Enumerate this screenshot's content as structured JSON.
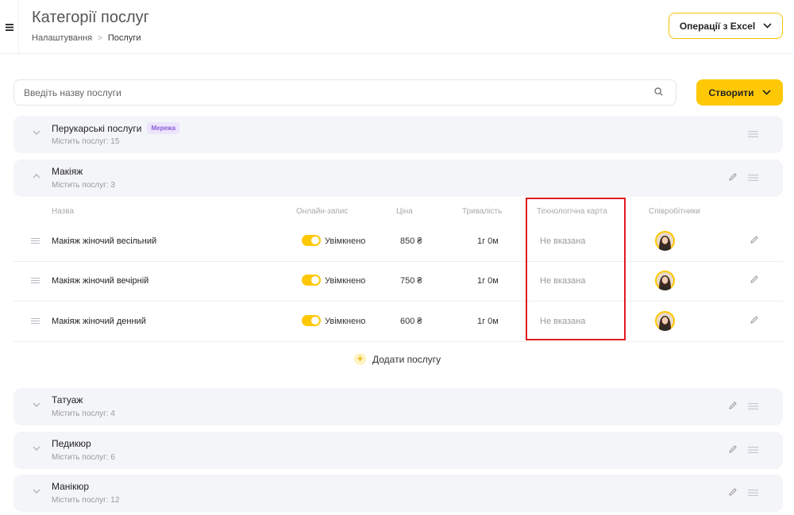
{
  "header": {
    "title": "Категорії послуг",
    "breadcrumb": {
      "parent": "Налаштування",
      "separator": ">",
      "current": "Послуги"
    },
    "excel_button": "Операції з Excel"
  },
  "search": {
    "placeholder": "Введіть назву послуги",
    "value": ""
  },
  "create_button": "Створити",
  "colors": {
    "accent": "#ffc805",
    "badge_bg": "#ece4fb",
    "badge_text": "#8b5fd6",
    "highlight": "#e11b22"
  },
  "categories": [
    {
      "name": "Перукарські послуги",
      "badge": "Мережа",
      "count": "Містить послуг: 15",
      "expanded": false
    },
    {
      "name": "Макіяж",
      "count": "Містить послуг: 3",
      "expanded": true
    },
    {
      "name": "Татуаж",
      "count": "Містить послуг: 4",
      "expanded": false
    },
    {
      "name": "Педикюр",
      "count": "Містить послуг: 6",
      "expanded": false
    },
    {
      "name": "Манікюр",
      "count": "Містить послуг: 12",
      "expanded": false
    }
  ],
  "table": {
    "columns": {
      "name": "Назва",
      "online": "Онлайн-запис",
      "price": "Ціна",
      "duration": "Тривалість",
      "techcard": "Технологічна карта",
      "staff": "Співробітники"
    },
    "rows": [
      {
        "name": "Макіяж жіночий весільний",
        "online": "Увімкнено",
        "online_on": true,
        "price": "850 ₴",
        "duration": "1г 0м",
        "techcard": "Не вказана"
      },
      {
        "name": "Макіяж жіночий вечірній",
        "online": "Увімкнено",
        "online_on": true,
        "price": "750 ₴",
        "duration": "1г 0м",
        "techcard": "Не вказана"
      },
      {
        "name": "Макіяж жіночий денний",
        "online": "Увімкнено",
        "online_on": true,
        "price": "600 ₴",
        "duration": "1г 0м",
        "techcard": "Не вказана"
      }
    ]
  },
  "add_service": {
    "plus": "+",
    "label": "Додати послугу"
  },
  "icons": [
    "menu-icon",
    "chevron-down-icon",
    "search-icon",
    "drag-handle-icon",
    "pencil-icon",
    "chevron-up-icon",
    "plus-icon"
  ]
}
